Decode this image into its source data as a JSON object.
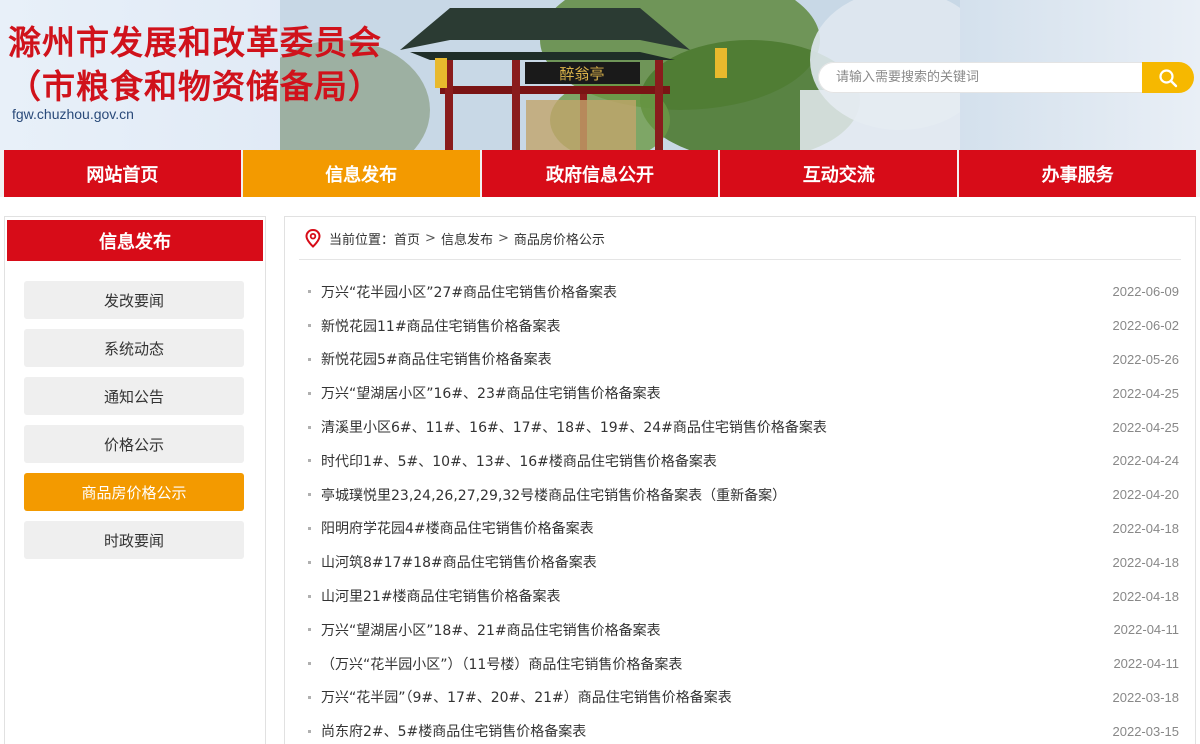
{
  "header": {
    "title_line1": "滁州市发展和改革委员会",
    "title_line2": "（市粮食和物资储备局）",
    "domain": "fgw.chuzhou.gov.cn",
    "search_placeholder": "请输入需要搜索的关键词",
    "search_icon": "magnifier-icon",
    "banner_sign": "醉翁亭"
  },
  "nav": {
    "items": [
      {
        "label": "网站首页"
      },
      {
        "label": "信息发布"
      },
      {
        "label": "政府信息公开"
      },
      {
        "label": "互动交流"
      },
      {
        "label": "办事服务"
      }
    ],
    "active_index": 1
  },
  "sidebar": {
    "title": "信息发布",
    "items": [
      {
        "label": "发改要闻"
      },
      {
        "label": "系统动态"
      },
      {
        "label": "通知公告"
      },
      {
        "label": "价格公示"
      },
      {
        "label": "商品房价格公示"
      },
      {
        "label": "时政要闻"
      }
    ],
    "active_index": 4
  },
  "breadcrumb": {
    "icon": "location-pin-icon",
    "prefix": "当前位置：",
    "items": [
      "首页",
      "信息发布",
      "商品房价格公示"
    ],
    "separator": ">"
  },
  "news": [
    {
      "title": "万兴“花半园小区”27#商品住宅销售价格备案表",
      "date": "2022-06-09"
    },
    {
      "title": "新悦花园11#商品住宅销售价格备案表",
      "date": "2022-06-02"
    },
    {
      "title": "新悦花园5#商品住宅销售价格备案表",
      "date": "2022-05-26"
    },
    {
      "title": "万兴“望湖居小区”16#、23#商品住宅销售价格备案表",
      "date": "2022-04-25"
    },
    {
      "title": "清溪里小区6#、11#、16#、17#、18#、19#、24#商品住宅销售价格备案表",
      "date": "2022-04-25"
    },
    {
      "title": "时代印1#、5#、10#、13#、16#楼商品住宅销售价格备案表",
      "date": "2022-04-24"
    },
    {
      "title": "亭城璞悦里23,24,26,27,29,32号楼商品住宅销售价格备案表（重新备案）",
      "date": "2022-04-20"
    },
    {
      "title": "阳明府学花园4#楼商品住宅销售价格备案表",
      "date": "2022-04-18"
    },
    {
      "title": "山河筑8#17#18#商品住宅销售价格备案表",
      "date": "2022-04-18"
    },
    {
      "title": "山河里21#楼商品住宅销售价格备案表",
      "date": "2022-04-18"
    },
    {
      "title": "万兴“望湖居小区”18#、21#商品住宅销售价格备案表",
      "date": "2022-04-11"
    },
    {
      "title": "（万兴“花半园小区”）（11号楼）商品住宅销售价格备案表",
      "date": "2022-04-11"
    },
    {
      "title": "万兴“花半园”（9#、17#、20#、21#）商品住宅销售价格备案表",
      "date": "2022-03-18"
    },
    {
      "title": "尚东府2#、5#楼商品住宅销售价格备案表",
      "date": "2022-03-15"
    }
  ],
  "colors": {
    "brand_red": "#d70c18",
    "accent_orange": "#f39a00",
    "search_yellow": "#f6b800"
  }
}
